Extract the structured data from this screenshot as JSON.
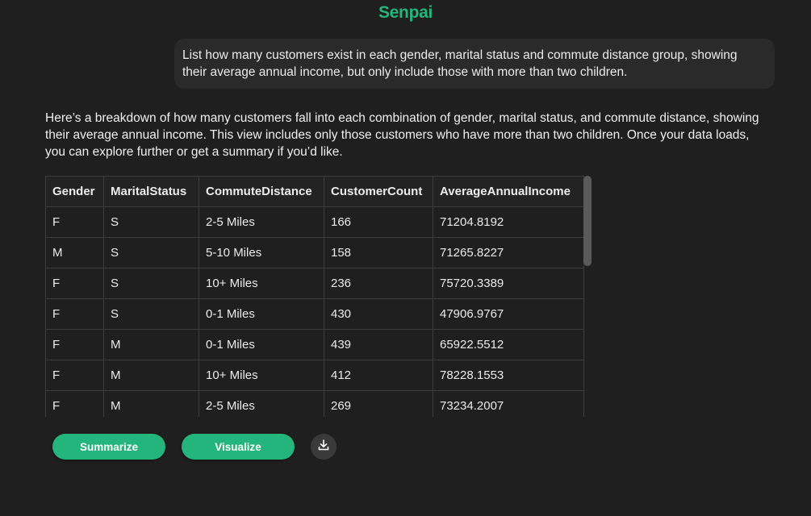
{
  "app": {
    "title": "Senpai"
  },
  "user_message": "List how many customers exist in each gender, marital status and commute distance group, showing their average annual income, but only include those with more than two children.",
  "assistant_message": "Here’s a breakdown of how many customers fall into each combination of gender, marital status, and commute distance, showing their average annual income. This view includes only those customers who have more than two children. Once your data loads, you can explore further or get a summary if you’d like.",
  "table": {
    "columns": [
      "Gender",
      "MaritalStatus",
      "CommuteDistance",
      "CustomerCount",
      "AverageAnnualIncome"
    ],
    "rows": [
      [
        "F",
        "S",
        "2-5 Miles",
        "166",
        "71204.8192"
      ],
      [
        "M",
        "S",
        "5-10 Miles",
        "158",
        "71265.8227"
      ],
      [
        "F",
        "S",
        "10+ Miles",
        "236",
        "75720.3389"
      ],
      [
        "F",
        "S",
        "0-1 Miles",
        "430",
        "47906.9767"
      ],
      [
        "F",
        "M",
        "0-1 Miles",
        "439",
        "65922.5512"
      ],
      [
        "F",
        "M",
        "10+ Miles",
        "412",
        "78228.1553"
      ],
      [
        "F",
        "M",
        "2-5 Miles",
        "269",
        "73234.2007"
      ]
    ]
  },
  "actions": {
    "summarize_label": "Summarize",
    "visualize_label": "Visualize",
    "download_icon": "download-icon"
  },
  "colors": {
    "accent": "#24b47e",
    "background": "#1f1f1f",
    "bubble": "#2a2a2a"
  }
}
